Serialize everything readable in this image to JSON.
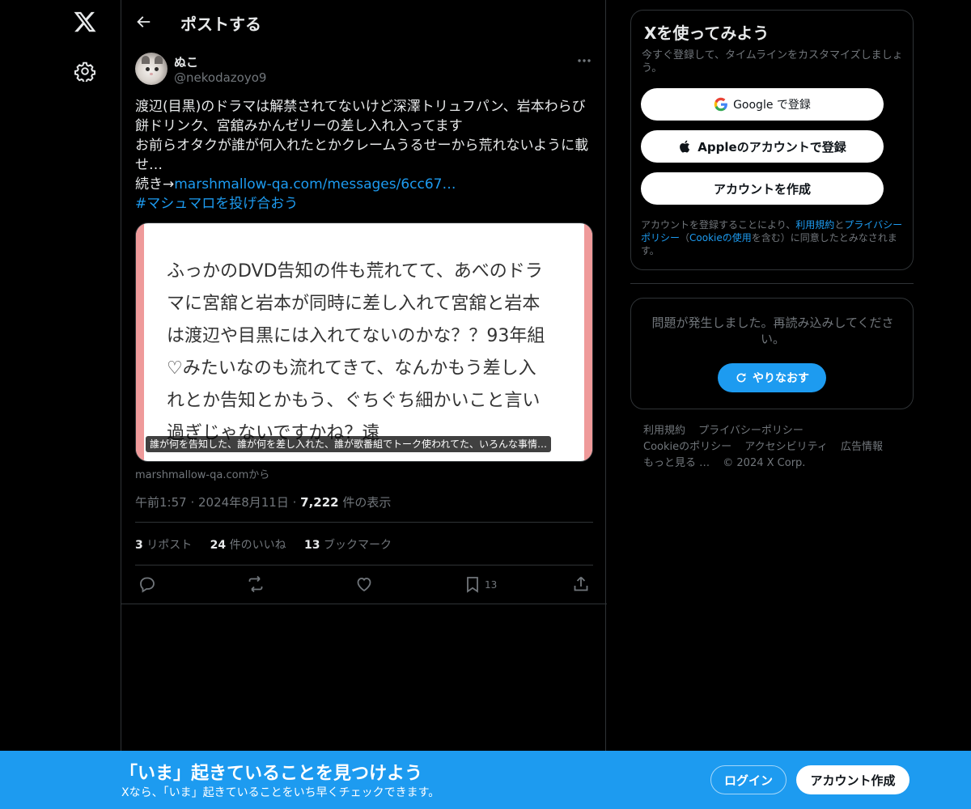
{
  "header": {
    "title": "ポストする",
    "back_icon": "back-arrow-icon"
  },
  "author": {
    "display_name": "ぬこ",
    "handle": "@nekodazoyo9"
  },
  "tweet": {
    "text_lines": [
      "渡辺(目黒)のドラマは解禁されてないけど深澤トリュフパン、岩本わらび",
      "餅ドリンク、宮舘みかんゼリーの差し入れ入ってます",
      "お前らオタクが誰が何入れたとかクレームうるせーから荒れないように載",
      "せ…"
    ],
    "continue_prefix": "続き→",
    "continue_link": "marshmallow-qa.com/messages/6cc67…",
    "hashtag": "#マシュマロを投げ合おう"
  },
  "media": {
    "lines": [
      "ふっかのDVD告知の件も荒れてて、あべのドラ",
      "マに宮舘と岩本が同時に差し入れて宮舘と岩本",
      "は渡辺や目黒には入れてないのかな？？93年組",
      "♡みたいなのも流れてきて、なんかもう差し入",
      "れとか告知とかもう、ぐちぐち細かいこと言い",
      "過ぎじゃないですかね？遠"
    ],
    "caption": "誰が何を告知した、誰が何を差し入れた、誰が歌番組でトーク使われてた、いろんな事情…",
    "source": "marshmallow-qa.comから"
  },
  "meta": {
    "time": "午前1:57",
    "date": "2024年8月11日",
    "views_count": "7,222",
    "views_label": "件の表示"
  },
  "stats": {
    "reposts_count": "3",
    "reposts_label": "リポスト",
    "likes_count": "24",
    "likes_label": "件のいいね",
    "bookmarks_count": "13",
    "bookmarks_label": "ブックマーク"
  },
  "actions": {
    "bookmark_count": "13"
  },
  "signup": {
    "title": "Xを使ってみよう",
    "subtitle": "今すぐ登録して、タイムラインをカスタマイズしましょう。",
    "google_label": "Google で登録",
    "apple_label": "Appleのアカウントで登録",
    "create_label": "アカウントを作成",
    "terms_prefix": "アカウントを登録することにより、",
    "terms_link": "利用規約",
    "terms_and": "と",
    "privacy_link": "プライバシーポリシー",
    "cookie_open": "（",
    "cookie_link": "Cookieの使用",
    "cookie_close": "を含む）に同意したとみなされます。"
  },
  "error": {
    "message": "問題が発生しました。再読み込みしてください。",
    "retry_label": "やりなおす"
  },
  "footer": {
    "terms": "利用規約",
    "privacy": "プライバシーポリシー",
    "cookie": "Cookieのポリシー",
    "accessibility": "アクセシビリティ",
    "ads": "広告情報",
    "more": "もっと見る …",
    "copyright": "© 2024 X Corp."
  },
  "banner": {
    "title": "「いま」起きていることを見つけよう",
    "subtitle": "Xなら、「いま」起きていることをいち早くチェックできます。",
    "login_label": "ログイン",
    "signup_label": "アカウント作成"
  },
  "colors": {
    "accent": "#1d9bf0",
    "background": "#000000",
    "border": "#2f3336",
    "muted": "#71767b"
  }
}
